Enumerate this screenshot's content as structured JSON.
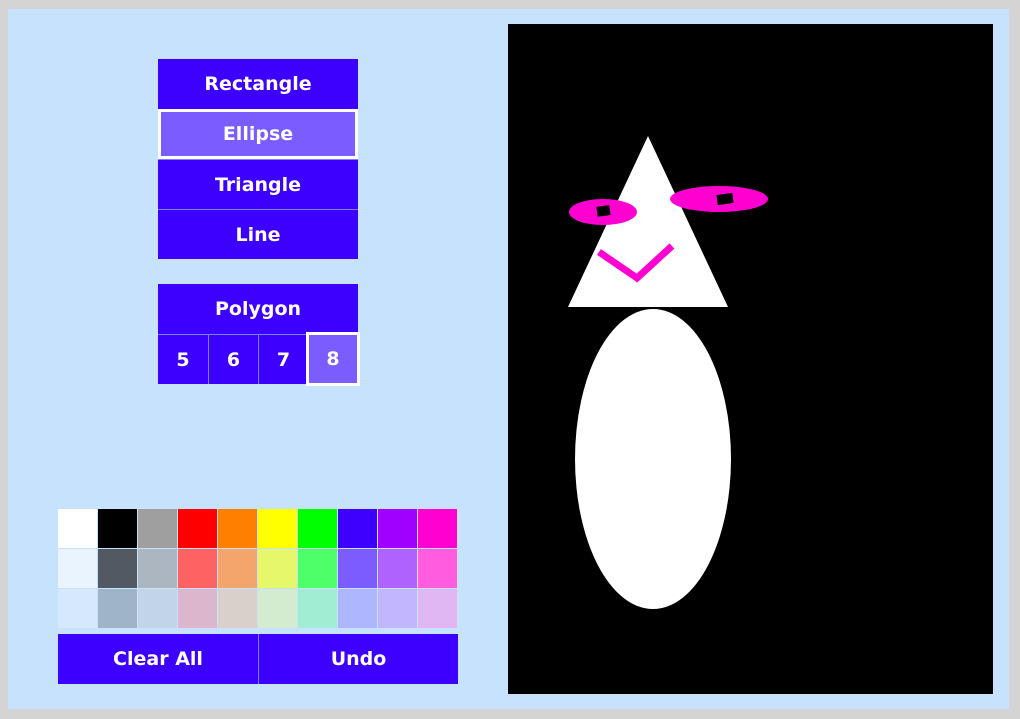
{
  "shapes": {
    "items": [
      {
        "label": "Rectangle",
        "selected": false
      },
      {
        "label": "Ellipse",
        "selected": true
      },
      {
        "label": "Triangle",
        "selected": false
      },
      {
        "label": "Line",
        "selected": false
      }
    ]
  },
  "polygon": {
    "label": "Polygon",
    "sides": [
      {
        "label": "5",
        "selected": false
      },
      {
        "label": "6",
        "selected": false
      },
      {
        "label": "7",
        "selected": false
      },
      {
        "label": "8",
        "selected": true
      }
    ]
  },
  "palette": {
    "rows": [
      [
        "#ffffff",
        "#000000",
        "#9f9f9f",
        "#ff0000",
        "#ff7f00",
        "#ffff00",
        "#00ff00",
        "#3d00ff",
        "#9f00ff",
        "#ff00d0"
      ],
      [
        "#e9f4fe",
        "#525962",
        "#acb6c1",
        "#ff6262",
        "#f4a56c",
        "#e7f76a",
        "#4fff6a",
        "#7d5cff",
        "#b062ff",
        "#ff5ce0"
      ],
      [
        "#d6e8fe",
        "#a0b4c8",
        "#c1d4e8",
        "#dbb6cc",
        "#d9d0cc",
        "#d3ebcf",
        "#a0edd4",
        "#aeb6fe",
        "#c2b7fe",
        "#e0b7f0"
      ]
    ]
  },
  "actions": {
    "clear_label": "Clear All",
    "undo_label": "Undo"
  },
  "colors": {
    "button": "#3d00ff",
    "button_selected": "#7a5cff",
    "panel_bg": "#c6e2fd",
    "canvas_bg": "#000000",
    "shape_white": "#ffffff",
    "shape_magenta": "#ff00d0"
  }
}
